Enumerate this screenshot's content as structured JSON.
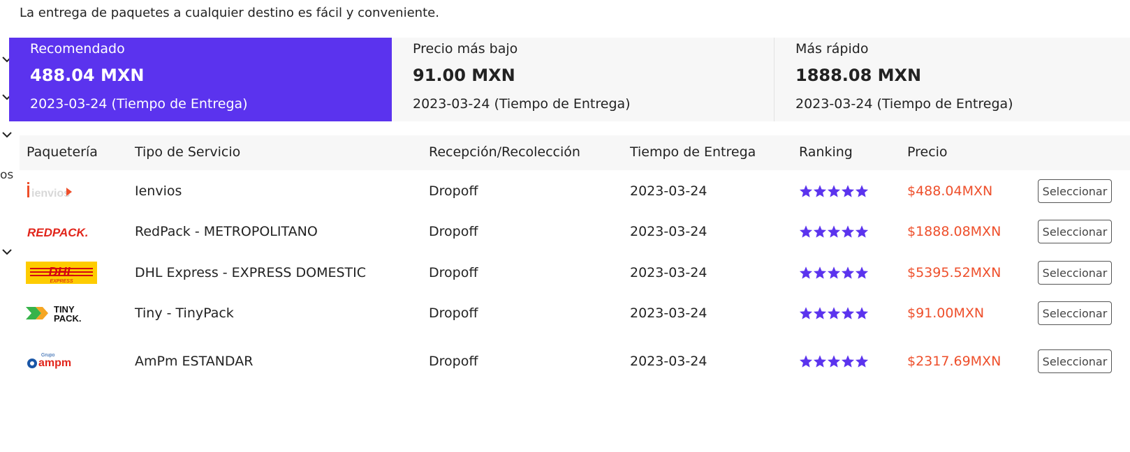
{
  "intro": "La entrega de paquetes a cualquier destino es fácil y conveniente.",
  "side_fragment": "os",
  "cards": [
    {
      "label": "Recomendado",
      "price": "488.04 MXN",
      "date": "2023-03-24 (Tiempo de Entrega)",
      "active": true
    },
    {
      "label": "Precio más bajo",
      "price": "91.00 MXN",
      "date": "2023-03-24 (Tiempo de Entrega)",
      "active": false
    },
    {
      "label": "Más rápido",
      "price": "1888.08 MXN",
      "date": "2023-03-24 (Tiempo de Entrega)",
      "active": false
    }
  ],
  "table": {
    "headers": [
      "Paquetería",
      "Tipo de Servicio",
      "Recepción/Recolección",
      "Tiempo de Entrega",
      "Ranking",
      "Precio"
    ],
    "rows": [
      {
        "carrier": "ienvios-logo",
        "service": "Ienvios",
        "pickup": "Dropoff",
        "delivery": "2023-03-24",
        "stars": 5,
        "price": "$488.04MXN",
        "button": "Seleccionar"
      },
      {
        "carrier": "redpack-logo",
        "service": "RedPack - METROPOLITANO",
        "pickup": "Dropoff",
        "delivery": "2023-03-24",
        "stars": 5,
        "price": "$1888.08MXN",
        "button": "Seleccionar"
      },
      {
        "carrier": "dhl-logo",
        "service": "DHL Express - EXPRESS DOMESTIC",
        "pickup": "Dropoff",
        "delivery": "2023-03-24",
        "stars": 5,
        "price": "$5395.52MXN",
        "button": "Seleccionar"
      },
      {
        "carrier": "tinypack-logo",
        "service": "Tiny - TinyPack",
        "pickup": "Dropoff",
        "delivery": "2023-03-24",
        "stars": 5,
        "price": "$91.00MXN",
        "button": "Seleccionar"
      },
      {
        "carrier": "ampm-logo",
        "service": "AmPm ESTANDAR",
        "pickup": "Dropoff",
        "delivery": "2023-03-24",
        "stars": 5,
        "price": "$2317.69MXN",
        "button": "Seleccionar"
      }
    ]
  },
  "logos": {
    "ienvios": "ienvios",
    "redpack": "REDPACK.",
    "dhl_main": "DHL",
    "dhl_sub": "EXPRESS",
    "tiny_line1": "TINY",
    "tiny_line2": "PACK.",
    "ampm_top": "Grupo",
    "ampm_main": "ampm"
  },
  "colors": {
    "accent": "#5b33ee",
    "price": "#ee4f2b",
    "card_bg": "#f7f7f7",
    "redpack": "#e1251b",
    "dhl_yellow": "#fecc00",
    "dhl_red": "#d40511",
    "tiny_green": "#37b34a",
    "tiny_orange": "#f5a623",
    "ampm_blue": "#1a56a6"
  },
  "icons": {
    "chevron": "chevron-down-icon",
    "star": "star-icon"
  }
}
